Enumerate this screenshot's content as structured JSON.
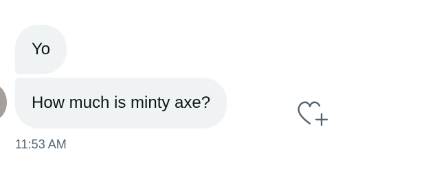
{
  "conversation": {
    "messages": [
      {
        "text": "Yo"
      },
      {
        "text": "How much is minty axe?"
      }
    ],
    "timestamp": "11:53 AM"
  },
  "icons": {
    "avatar": "avatar-image",
    "react": "heart-plus-icon"
  },
  "colors": {
    "bubble_bg": "#eff3f4",
    "text": "#0f1419",
    "timestamp": "#536471",
    "icon": "#536471"
  }
}
